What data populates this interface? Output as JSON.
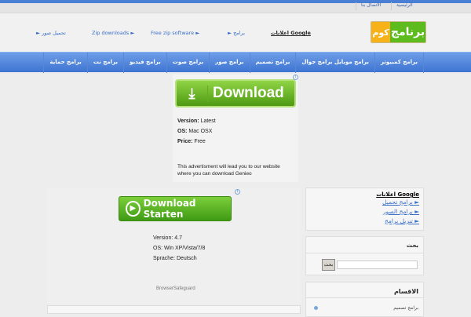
{
  "topbar": {
    "links": [
      "الرئيسية",
      "الاتصال بنا"
    ]
  },
  "logo": {
    "text_a": "كوم",
    "text_b": "برنامج"
  },
  "header": {
    "google_ads": "اعلانات Google",
    "links": [
      "► برامج",
      "Free zip software ►",
      "Zip downloads ►",
      "► تحميل صور"
    ]
  },
  "nav": {
    "items": [
      "برامج كمبيوتر",
      "برامج موبايل برامج جوال",
      "برامج تصميم",
      "برامج صور",
      "برامج صوت",
      "برامج فيديو",
      "برامج نت",
      "برامج حماية"
    ]
  },
  "ad1": {
    "button": "Download",
    "version_label": "Version:",
    "version": "Latest",
    "os_label": "OS:",
    "os": "Mac OSX",
    "price_label": "Price:",
    "price": "Free",
    "note": "This advertisment will lead you to our website where you can download Genieo",
    "info": "i"
  },
  "ad2": {
    "button": "Download Starten",
    "version": "Version: 4.7",
    "os": "OS: Win XP/Vista/7/8",
    "lang": "Sprache: Deutsch",
    "brand": "BrowserSafeguard",
    "info": "i"
  },
  "sidebar": {
    "google_ads": "اعلانات Google",
    "ad_links": [
      "► برامج تحميل",
      "► برامج الصور",
      "► تنزيل برامج"
    ],
    "search_title": "بحث",
    "search_button": "بحث",
    "search_value": "",
    "categories_title": "الاقسام",
    "categories": [
      "برامج تصميم"
    ]
  }
}
